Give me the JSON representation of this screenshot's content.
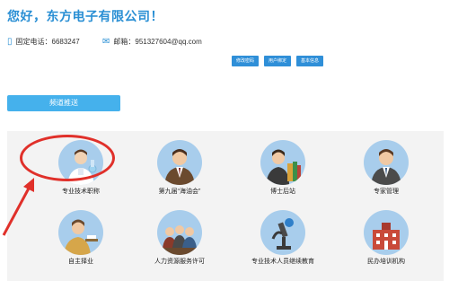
{
  "header": {
    "greeting": "您好，东方电子有限公司！",
    "phone_label": "固定电话：6683247",
    "email_label": "邮箱：951327604@qq.com"
  },
  "actions": [
    {
      "label": "修改密码"
    },
    {
      "label": "用户绑定"
    },
    {
      "label": "基本信息"
    }
  ],
  "push_button": "频道推送",
  "services": [
    {
      "label": "专业技术职称",
      "icon": "scientist-icon"
    },
    {
      "label": "第九届“海油会”",
      "icon": "man-icon"
    },
    {
      "label": "博士后站",
      "icon": "scholar-books-icon"
    },
    {
      "label": "专家管理",
      "icon": "expert-icon"
    },
    {
      "label": "自主择业",
      "icon": "entrepreneur-icon"
    },
    {
      "label": "人力资源服务许可",
      "icon": "group-icon"
    },
    {
      "label": "专业技术人员继续教育",
      "icon": "microscope-icon"
    },
    {
      "label": "民办培训机构",
      "icon": "building-icon"
    }
  ],
  "colors": {
    "accent": "#2a8fd4",
    "button": "#2f8fd8",
    "push": "#45b1ec",
    "highlight": "#e0302a",
    "avatar_bg": "#a8cdec"
  }
}
